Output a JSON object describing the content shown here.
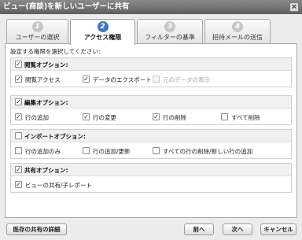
{
  "window": {
    "title": "ビュー(商談)を新しいユーザーに共有",
    "close_glyph": "×"
  },
  "tabs": [
    {
      "number": "1",
      "label": "ユーザーの選択",
      "active": false
    },
    {
      "number": "2",
      "label": "アクセス権限",
      "active": true
    },
    {
      "number": "3",
      "label": "フィルターの基準",
      "active": false
    },
    {
      "number": "4",
      "label": "招待メールの送信",
      "active": false
    }
  ],
  "panel": {
    "instruction": "設定する権限を選択してください:",
    "groups": [
      {
        "header": "閲覧オプション:",
        "checked": true,
        "options": [
          {
            "label": "閲覧アクセス",
            "checked": true,
            "disabled": false
          },
          {
            "label": "データのエクスポート",
            "checked": true,
            "disabled": false
          },
          {
            "label": "元のデータの表示",
            "checked": false,
            "disabled": true
          }
        ]
      },
      {
        "header": "編集オプション:",
        "checked": true,
        "options": [
          {
            "label": "行の追加",
            "checked": true,
            "disabled": false
          },
          {
            "label": "行の変更",
            "checked": true,
            "disabled": false
          },
          {
            "label": "行の削除",
            "checked": true,
            "disabled": false
          },
          {
            "label": "すべて削除",
            "checked": false,
            "disabled": false
          }
        ]
      },
      {
        "header": "インポートオプション:",
        "checked": false,
        "options": [
          {
            "label": "行の追加のみ",
            "checked": false,
            "disabled": false
          },
          {
            "label": "行の追加/更新",
            "checked": false,
            "disabled": false
          },
          {
            "label": "すべての行の削除/新しい行の追加",
            "checked": false,
            "disabled": false
          }
        ]
      },
      {
        "header": "共有オプション:",
        "checked": true,
        "options": [
          {
            "label": "ビューの共有/子レポート",
            "checked": true,
            "disabled": false
          }
        ]
      }
    ]
  },
  "footer": {
    "details_button": "既存の共有の詳細",
    "back_button": "前へ",
    "next_button": "次へ",
    "cancel_button": "キャンセル"
  },
  "check_glyph": "✓"
}
